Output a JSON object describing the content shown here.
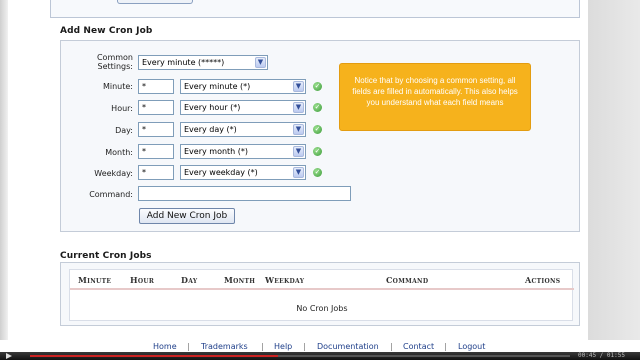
{
  "add_section": {
    "title": "Add New Cron Job",
    "common_settings_label_1": "Common",
    "common_settings_label_2": "Settings:",
    "common_settings_value": "Every minute (*****)",
    "fields": [
      {
        "label": "Minute:",
        "value": "*",
        "select": "Every minute (*)"
      },
      {
        "label": "Hour:",
        "value": "*",
        "select": "Every hour (*)"
      },
      {
        "label": "Day:",
        "value": "*",
        "select": "Every day (*)"
      },
      {
        "label": "Month:",
        "value": "*",
        "select": "Every month (*)"
      },
      {
        "label": "Weekday:",
        "value": "*",
        "select": "Every weekday (*)"
      }
    ],
    "command_label": "Command:",
    "command_value": "",
    "add_button_label": "Add New Cron Job",
    "tooltip": "Notice that by choosing a common setting, all fields are filled in automatically. This also helps you understand what each field means"
  },
  "current_section": {
    "title": "Current Cron Jobs",
    "columns": [
      "Minute",
      "Hour",
      "Day",
      "Month",
      "Weekday",
      "Command",
      "Actions"
    ],
    "empty_text": "No Cron Jobs"
  },
  "footer": {
    "links": [
      "Home",
      "Trademarks",
      "Help",
      "Documentation",
      "Contact",
      "Logout"
    ]
  },
  "player": {
    "progress": 0.46,
    "time": "00:45 / 01:55"
  },
  "colors": {
    "tooltip_bg": "#f6b21c",
    "link": "#1f3f8a",
    "ok_icon": "#3c9b3a"
  }
}
